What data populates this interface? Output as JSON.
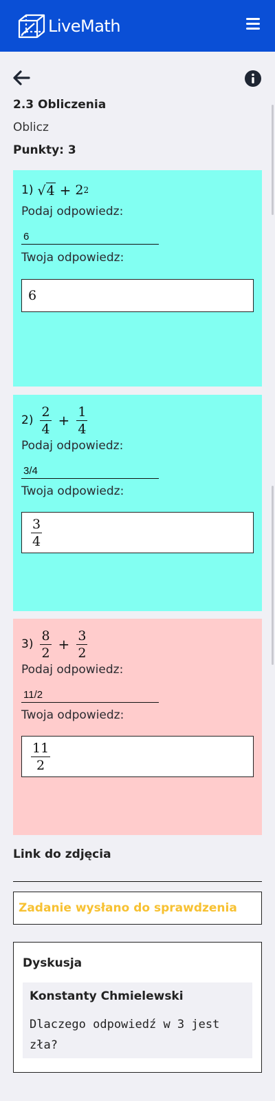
{
  "header": {
    "logo_text": "LiveMath",
    "logo_icon": "cube-logo-icon",
    "menu_icon": "hamburger-menu-icon",
    "color": "#0a4fd6"
  },
  "toolbar": {
    "back_icon": "arrow-left-icon",
    "info_icon": "info-circle-icon"
  },
  "exercise": {
    "title": "2.3 Obliczenia",
    "instruction": "Oblicz",
    "points_label": "Punkty: 3"
  },
  "tasks": [
    {
      "number": "1)",
      "expression": {
        "sqrt_arg": "4",
        "plus": "+",
        "base": "2",
        "exponent": "2"
      },
      "prompt_label": "Podaj odpowiedz:",
      "answer_value": "6",
      "preview_label": "Twoja odpowiedz:",
      "preview": "6",
      "status": "correct",
      "color": "#82fff2"
    },
    {
      "number": "2)",
      "expression": {
        "a_num": "2",
        "a_den": "4",
        "plus": "+",
        "b_num": "1",
        "b_den": "4"
      },
      "prompt_label": "Podaj odpowiedz:",
      "answer_value": "3/4",
      "preview_label": "Twoja odpowiedz:",
      "preview": {
        "num": "3",
        "den": "4"
      },
      "status": "correct",
      "color": "#82fff2"
    },
    {
      "number": "3)",
      "expression": {
        "a_num": "8",
        "a_den": "2",
        "plus": "+",
        "b_num": "3",
        "b_den": "2"
      },
      "prompt_label": "Podaj odpowiedz:",
      "answer_value": "11/2",
      "preview_label": "Twoja odpowiedz:",
      "preview": {
        "num": "11",
        "den": "2"
      },
      "status": "incorrect",
      "color": "#ffcccc"
    }
  ],
  "photo_link": {
    "label": "Link do zdjęcia",
    "value": ""
  },
  "status_message": {
    "text": "Zadanie wysłano do sprawdzenia",
    "color": "#f7c132"
  },
  "discussion": {
    "title": "Dyskusja",
    "comments": [
      {
        "author": "Konstanty Chmielewski",
        "text": "Dlaczego odpowiedź w 3 jest zła?"
      }
    ]
  }
}
